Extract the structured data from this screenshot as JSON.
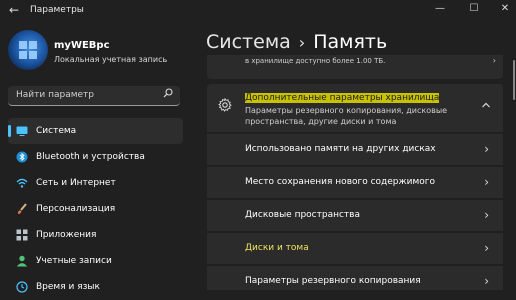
{
  "window": {
    "title": "Параметры",
    "back_glyph": "←",
    "minimize_glyph": "—",
    "maximize_glyph": "☐",
    "close_glyph": "✕"
  },
  "user": {
    "name": "myWEBpc",
    "account_type": "Локальная учетная запись"
  },
  "search": {
    "placeholder": "Найти параметр",
    "icon": "search-icon"
  },
  "nav": {
    "items": [
      {
        "label": "Система",
        "icon": "system-display-icon",
        "active": true
      },
      {
        "label": "Bluetooth и устройства",
        "icon": "bluetooth-icon"
      },
      {
        "label": "Сеть и Интернет",
        "icon": "wifi-icon"
      },
      {
        "label": "Персонализация",
        "icon": "brush-icon"
      },
      {
        "label": "Приложения",
        "icon": "apps-icon"
      },
      {
        "label": "Учетные записи",
        "icon": "accounts-icon"
      },
      {
        "label": "Время и язык",
        "icon": "time-language-icon"
      }
    ]
  },
  "breadcrumb": {
    "parent": "Система",
    "separator": "›",
    "current": "Память"
  },
  "partial_card": {
    "text": "в хранилище доступно более 1.00 ТБ."
  },
  "advanced": {
    "title": "Дополнительные параметры хранилища",
    "description": "Параметры резервного копирования, дисковые пространства, другие диски и тома",
    "highlight_color": "#c8c200"
  },
  "rows": [
    {
      "label": "Использовано памяти на других дисках",
      "highlighted": false
    },
    {
      "label": "Место сохранения нового содержимого",
      "highlighted": false
    },
    {
      "label": "Дисковые пространства",
      "highlighted": false
    },
    {
      "label": "Диски и тома",
      "highlighted": true
    },
    {
      "label": "Параметры резервного копирования",
      "highlighted": false
    }
  ],
  "colors": {
    "accent": "#4cc2ff",
    "background": "#202020",
    "card": "#2b2b2b",
    "highlight_text": "#f0e45a"
  }
}
